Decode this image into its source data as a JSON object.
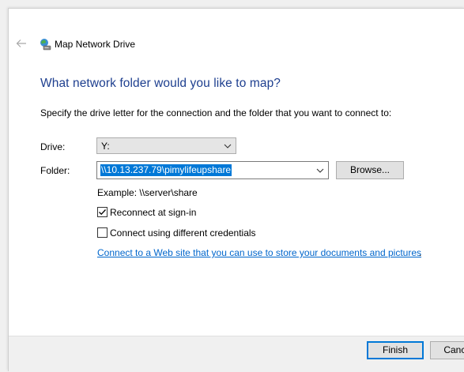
{
  "window": {
    "title": "Map Network Drive"
  },
  "header": {
    "heading": "What network folder would you like to map?",
    "instructions": "Specify the drive letter for the connection and the folder that you want to connect to:"
  },
  "form": {
    "drive_label": "Drive:",
    "drive_value": "Y:",
    "folder_label": "Folder:",
    "folder_value": "\\\\10.13.237.79\\pimylifeupshare",
    "browse_label": "Browse...",
    "example_text": "Example: \\\\server\\share",
    "reconnect_label": "Reconnect at sign-in",
    "reconnect_checked": true,
    "credentials_label": "Connect using different credentials",
    "credentials_checked": false,
    "web_link_text": "Connect to a Web site that you can use to store your documents and pictures",
    "web_link_suffix": "."
  },
  "footer": {
    "finish_label": "Finish",
    "cancel_label": "Cancel"
  },
  "icons": {
    "back": "back-arrow-icon",
    "title": "network-drive-icon",
    "dropdown": "chevron-down-icon",
    "check": "checkmark-icon"
  },
  "colors": {
    "heading": "#1e3f8f",
    "selection": "#0078d7",
    "link": "#0066cc",
    "dialog_bg": "#ffffff",
    "footer_bg": "#f0f0f0"
  }
}
